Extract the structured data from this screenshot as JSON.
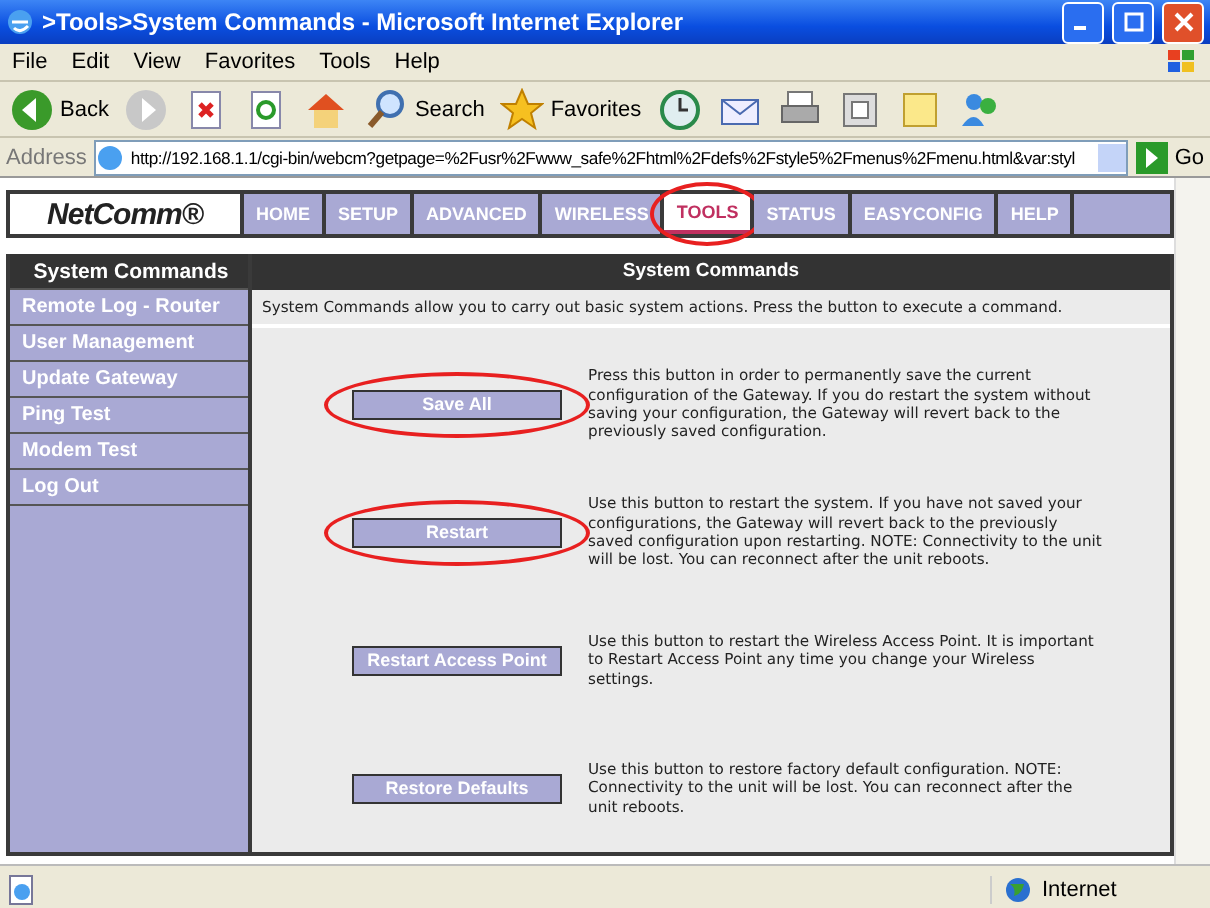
{
  "window": {
    "title": ">Tools>System Commands - Microsoft Internet Explorer"
  },
  "menu": [
    "File",
    "Edit",
    "View",
    "Favorites",
    "Tools",
    "Help"
  ],
  "toolbar": [
    {
      "kind": "back",
      "label": "Back"
    },
    {
      "kind": "forward"
    },
    {
      "kind": "stop"
    },
    {
      "kind": "refresh"
    },
    {
      "kind": "home"
    },
    {
      "kind": "search",
      "label": "Search"
    },
    {
      "kind": "favorites",
      "label": "Favorites"
    },
    {
      "kind": "history"
    },
    {
      "kind": "mail"
    },
    {
      "kind": "print"
    },
    {
      "kind": "edit"
    },
    {
      "kind": "note"
    },
    {
      "kind": "messenger"
    }
  ],
  "address": {
    "label": "Address",
    "url": "http://192.168.1.1/cgi-bin/webcm?getpage=%2Fusr%2Fwww_safe%2Fhtml%2Fdefs%2Fstyle5%2Fmenus%2Fmenu.html&var:styl",
    "go": "Go"
  },
  "logo": "NetComm®",
  "tabs": [
    {
      "label": "HOME",
      "selected": false,
      "circled": false
    },
    {
      "label": "SETUP",
      "selected": false,
      "circled": false
    },
    {
      "label": "ADVANCED",
      "selected": false,
      "circled": false
    },
    {
      "label": "WIRELESS",
      "selected": false,
      "circled": false
    },
    {
      "label": "TOOLS",
      "selected": true,
      "circled": true
    },
    {
      "label": "STATUS",
      "selected": false,
      "circled": false
    },
    {
      "label": "EASYCONFIG",
      "selected": false,
      "circled": false
    },
    {
      "label": "HELP",
      "selected": false,
      "circled": false
    }
  ],
  "sidebar": {
    "items": [
      {
        "label": "System Commands",
        "selected": true
      },
      {
        "label": "Remote Log - Router",
        "selected": false
      },
      {
        "label": "User Management",
        "selected": false
      },
      {
        "label": "Update Gateway",
        "selected": false
      },
      {
        "label": "Ping Test",
        "selected": false
      },
      {
        "label": "Modem Test",
        "selected": false
      },
      {
        "label": "Log Out",
        "selected": false
      }
    ]
  },
  "panel": {
    "title": "System Commands",
    "intro": "System Commands allow you to carry out basic system actions. Press the button to execute a command.",
    "commands": [
      {
        "label": "Save All",
        "circled": true,
        "description": "Press this button in order to permanently save the current configuration of the Gateway. If you do restart the system without saving your configuration, the Gateway will revert back to the previously saved configuration."
      },
      {
        "label": "Restart",
        "circled": true,
        "description": "Use this button to restart the system. If you have not saved your configurations, the Gateway will revert back to the previously saved configuration upon restarting. NOTE: Connectivity to the unit will be lost. You can reconnect after the unit reboots."
      },
      {
        "label": "Restart Access Point",
        "circled": false,
        "description": "Use this button to restart the Wireless Access Point. It is important to Restart Access Point any time you change your Wireless settings."
      },
      {
        "label": "Restore Defaults",
        "circled": false,
        "description": "Use this button to restore factory default configuration. NOTE: Connectivity to the unit will be lost. You can reconnect after the unit reboots."
      }
    ]
  },
  "status_bar": {
    "zone": "Internet"
  }
}
